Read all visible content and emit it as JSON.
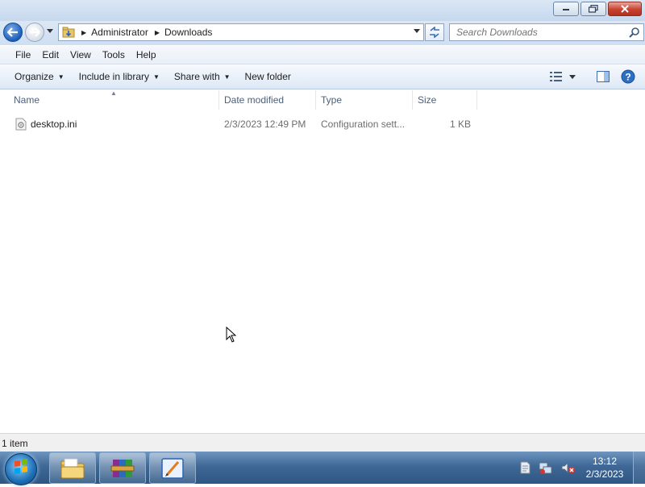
{
  "window": {
    "controls": {
      "minimize": "minimize",
      "maximize": "maximize",
      "close": "close"
    }
  },
  "address": {
    "breadcrumb": [
      "Administrator",
      "Downloads"
    ]
  },
  "search": {
    "placeholder": "Search Downloads"
  },
  "menu": [
    "File",
    "Edit",
    "View",
    "Tools",
    "Help"
  ],
  "commands": {
    "organize": "Organize",
    "include_in_library": "Include in library",
    "share_with": "Share with",
    "new_folder": "New folder"
  },
  "columns": {
    "name": "Name",
    "date_modified": "Date modified",
    "type": "Type",
    "size": "Size"
  },
  "files": [
    {
      "name": "desktop.ini",
      "date_modified": "2/3/2023 12:49 PM",
      "type": "Configuration sett...",
      "size": "1 KB",
      "icon": "ini-file-icon"
    }
  ],
  "status": {
    "item_count": "1 item"
  },
  "taskbar": {
    "pinned": [
      "file-explorer-icon",
      "winrar-icon",
      "pen-app-icon"
    ],
    "tray_icons": [
      "action-center-icon",
      "network-icon",
      "volume-muted-icon"
    ],
    "clock_time": "13:12",
    "clock_date": "2/3/2023"
  },
  "colors": {
    "accent": "#1d5fb8",
    "titlebar": "#c6d8ee",
    "taskbar": "#3f6896",
    "close": "#c8412f"
  }
}
